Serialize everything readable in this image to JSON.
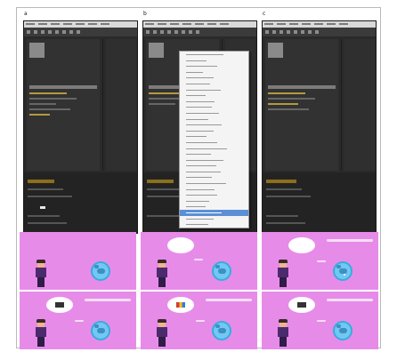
{
  "panels": {
    "labels": [
      "a",
      "b",
      "c"
    ]
  },
  "context_menu": {
    "rows": 30,
    "highlighted_index": 27
  },
  "scenes": {
    "count": 6,
    "colors": {
      "background": "#e78be9",
      "shirt": "#4c2a6e",
      "globe": "#6fc9f0"
    }
  },
  "colors": {
    "editor_bg": "#2a2a2a",
    "timeline_accent": "#8c6f1b",
    "menu_highlight": "#5b8fd6"
  }
}
